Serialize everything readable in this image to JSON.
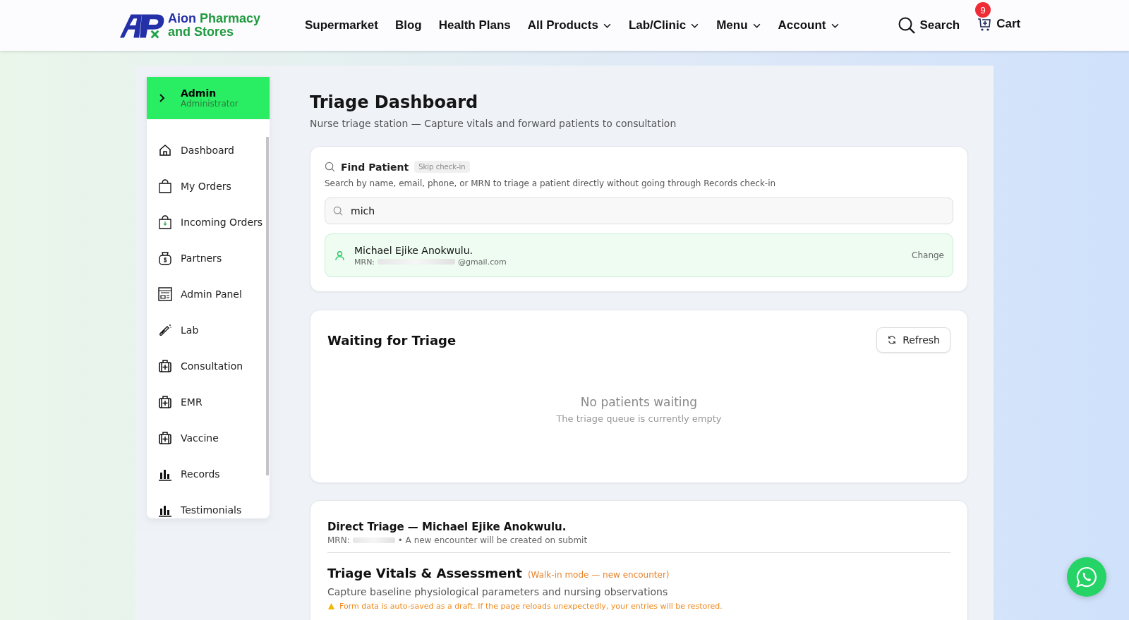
{
  "brand": {
    "line1a": "Aion",
    "line1b": "Pharmacy",
    "line2": "and Stores"
  },
  "nav": [
    {
      "label": "Supermarket",
      "dropdown": false
    },
    {
      "label": "Blog",
      "dropdown": false
    },
    {
      "label": "Health Plans",
      "dropdown": false
    },
    {
      "label": "All Products",
      "dropdown": true
    },
    {
      "label": "Lab/Clinic",
      "dropdown": true
    },
    {
      "label": "Menu",
      "dropdown": true
    },
    {
      "label": "Account",
      "dropdown": true
    }
  ],
  "search": {
    "label": "Search"
  },
  "cart": {
    "label": "Cart",
    "count": "9"
  },
  "user": {
    "name": "Admin",
    "role": "Administrator"
  },
  "sidebar": {
    "items": [
      {
        "label": "Dashboard"
      },
      {
        "label": "My Orders"
      },
      {
        "label": "Incoming Orders"
      },
      {
        "label": "Partners"
      },
      {
        "label": "Admin Panel"
      },
      {
        "label": "Lab"
      },
      {
        "label": "Consultation"
      },
      {
        "label": "EMR"
      },
      {
        "label": "Vaccine"
      },
      {
        "label": "Records"
      },
      {
        "label": "Testimonials"
      }
    ]
  },
  "page": {
    "title": "Triage Dashboard",
    "subtitle": "Nurse triage station — Capture vitals and forward patients to consultation"
  },
  "find": {
    "title": "Find Patient",
    "badge": "Skip check-in",
    "hint": "Search by name, email, phone, or MRN to triage a patient directly without going through Records check-in",
    "query": "mich",
    "result": {
      "name": "Michael Ejike Anokwulu.",
      "mrn_label": "MRN:",
      "email_tail": "@gmail.com",
      "action": "Change"
    }
  },
  "queue": {
    "title": "Waiting for Triage",
    "refresh": "Refresh",
    "empty_title": "No patients waiting",
    "empty_text": "The triage queue is currently empty"
  },
  "direct": {
    "title": "Direct Triage — Michael Ejike Anokwulu.",
    "mrn_label": "MRN:",
    "note": "• A new encounter will be created on submit",
    "section_title": "Triage Vitals & Assessment",
    "mode": "(Walk-in mode — new encounter)",
    "description": "Capture baseline physiological parameters and nursing observations",
    "warning": "Form data is auto-saved as a draft. If the page reloads unexpectedly, your entries will be restored."
  }
}
